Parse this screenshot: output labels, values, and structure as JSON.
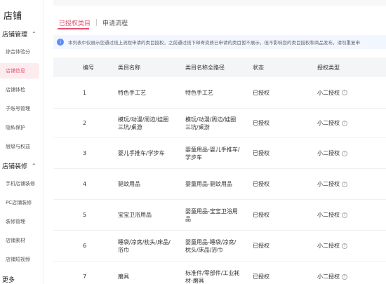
{
  "sidebar": {
    "title": "店铺",
    "groups": [
      {
        "label": "店铺管理",
        "items": [
          "综合体验分",
          "店铺信息",
          "店铺体检",
          "子账号管理",
          "隐私保护",
          "层级与权益"
        ]
      },
      {
        "label": "店铺装修",
        "items": [
          "手机店铺装修",
          "PC店铺装修",
          "装修管理",
          "店铺素材",
          "店铺短视频"
        ]
      }
    ],
    "active_item": "店铺信息",
    "more": "更多"
  },
  "tabs": [
    {
      "label": "已授权类目",
      "active": true
    },
    {
      "label": "申请流程",
      "active": false
    }
  ],
  "notice": {
    "text": "本列表中仅展示您通过线上流程申请的类目授权，之前通过线下邮寄资质已申请的类目暂不展示，但不影响您的类目授权和商品发布，请勿重复申"
  },
  "table": {
    "headers": [
      "编号",
      "类目名称",
      "类目名称全路径",
      "状态",
      "授权类型"
    ],
    "rows": [
      {
        "no": "1",
        "name": "特色手工艺",
        "path": "特色手工艺",
        "status": "已授权",
        "type": "小二授权"
      },
      {
        "no": "2",
        "name": "模玩/动漫/周边/娃圈三坑/桌游",
        "path": "模玩/动漫/周边/娃圈三坑/桌游",
        "status": "已授权",
        "type": "小二授权"
      },
      {
        "no": "3",
        "name": "婴儿手推车/学步车",
        "path": "婴童用品-婴儿手推车/学步车",
        "status": "已授权",
        "type": "小二授权"
      },
      {
        "no": "4",
        "name": "驱蚊用品",
        "path": "婴童用品-驱蚊用品",
        "status": "已授权",
        "type": "小二授权"
      },
      {
        "no": "5",
        "name": "宝宝卫浴用品",
        "path": "婴童用品-宝宝卫浴用品",
        "status": "已授权",
        "type": "小二授权"
      },
      {
        "no": "6",
        "name": "睡袋/凉席/枕头/床品/浴巾",
        "path": "婴童用品-睡袋/凉席/枕头/床品/浴巾",
        "status": "已授权",
        "type": "小二授权"
      },
      {
        "no": "7",
        "name": "磨具",
        "path": "标准件/零部件/工业耗材-磨具",
        "status": "已授权",
        "type": "小二授权"
      }
    ]
  },
  "colors": {
    "accent": "#e8506e",
    "notice_bg": "#f2f6ff",
    "info_icon": "#5b8def",
    "table_header_bg": "#f4f5f7"
  }
}
